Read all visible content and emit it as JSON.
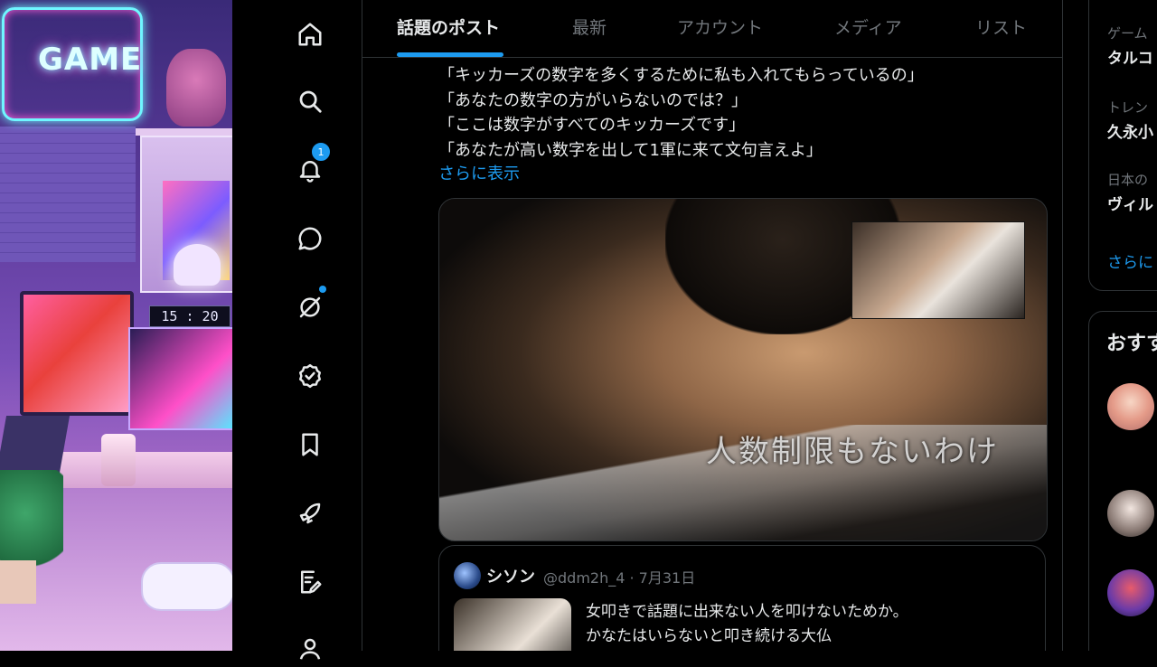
{
  "wallpaper": {
    "neon_text": "GAME",
    "clock": "15 : 20"
  },
  "nav": {
    "notifications_badge": "1"
  },
  "tabs": [
    {
      "label": "話題のポスト",
      "active": true
    },
    {
      "label": "最新",
      "active": false
    },
    {
      "label": "アカウント",
      "active": false
    },
    {
      "label": "メディア",
      "active": false
    },
    {
      "label": "リスト",
      "active": false
    }
  ],
  "post": {
    "lines": [
      "「キッカーズの数字を多くするために私も入れてもらっているの」",
      "「あなたの数字の方がいらないのでは？」",
      "「ここは数字がすべてのキッカーズです」",
      "「あなたが高い数字を出して1軍に来て文句言えよ」"
    ],
    "show_more": "さらに表示",
    "video_subtitle": "人数制限もないわけ"
  },
  "quote": {
    "name": "シソン",
    "handle_date": "@ddm2h_4 · 7月31日",
    "lines": [
      "女叩きで話題に出来ない人を叩けないためか。",
      "かなたはいらないと叩き続ける大仏"
    ]
  },
  "sidebar": {
    "trends": [
      {
        "category": "ゲーム",
        "name": "タルコ"
      },
      {
        "category": "トレン",
        "name": "久永小"
      },
      {
        "category": "日本の",
        "name": "ヴィル"
      }
    ],
    "show_more": "さらに",
    "follow_title": "おすす"
  },
  "colors": {
    "accent": "#1d9bf0",
    "background": "#000000",
    "text": "#e7e9ea",
    "muted": "#71767b",
    "border": "#2f3336"
  }
}
